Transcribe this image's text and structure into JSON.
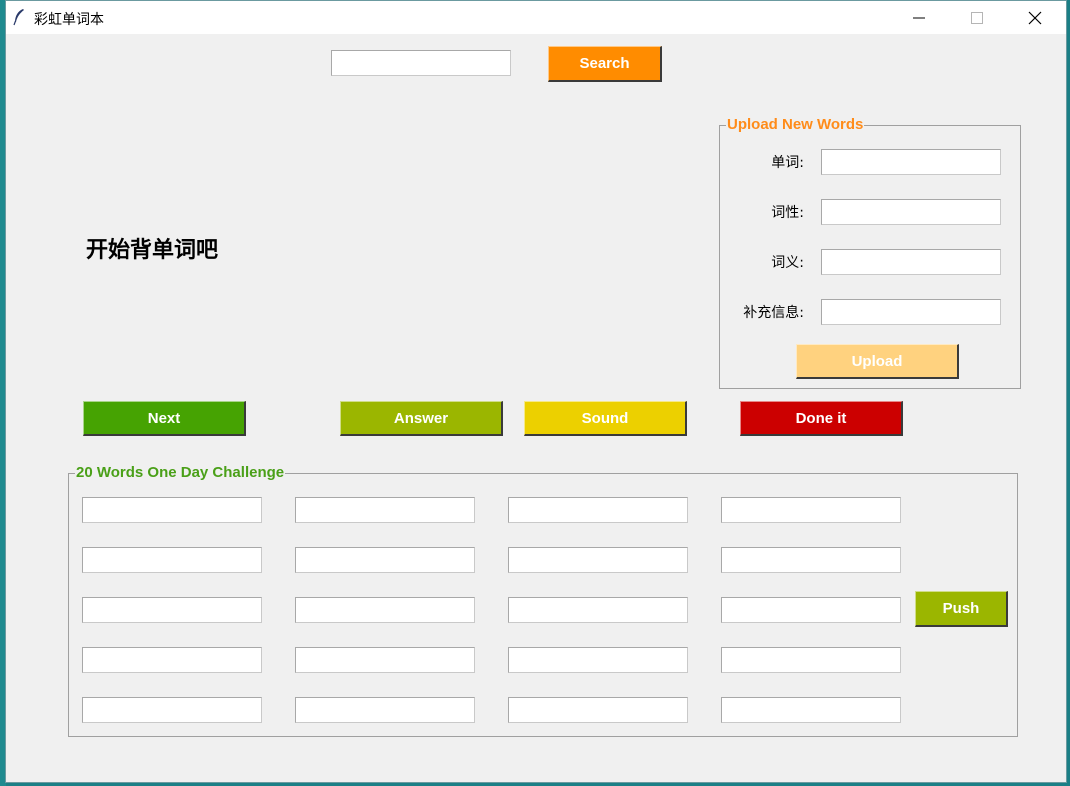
{
  "window": {
    "title": "彩虹单词本"
  },
  "search": {
    "value": "",
    "button_label": "Search",
    "button_color": "#ff8c00"
  },
  "main": {
    "prompt_text": "开始背单词吧"
  },
  "upload": {
    "legend": "Upload New Words",
    "legend_color": "#ff8c1a",
    "fields": [
      {
        "label": "单词:",
        "value": ""
      },
      {
        "label": "词性:",
        "value": ""
      },
      {
        "label": "词义:",
        "value": ""
      },
      {
        "label": "补充信息:",
        "value": ""
      }
    ],
    "button_label": "Upload",
    "button_color": "#ffd27f"
  },
  "actions": [
    {
      "label": "Next",
      "color": "#46a302"
    },
    {
      "label": "Answer",
      "color": "#9bb600"
    },
    {
      "label": "Sound",
      "color": "#ecd000"
    },
    {
      "label": "Done it",
      "color": "#cc0000"
    }
  ],
  "challenge": {
    "legend": "20 Words One Day Challenge",
    "legend_color": "#4aa018",
    "grid": [
      [
        "",
        "",
        "",
        ""
      ],
      [
        "",
        "",
        "",
        ""
      ],
      [
        "",
        "",
        "",
        ""
      ],
      [
        "",
        "",
        "",
        ""
      ],
      [
        "",
        "",
        "",
        ""
      ]
    ],
    "push_label": "Push",
    "push_color": "#9bb600"
  }
}
